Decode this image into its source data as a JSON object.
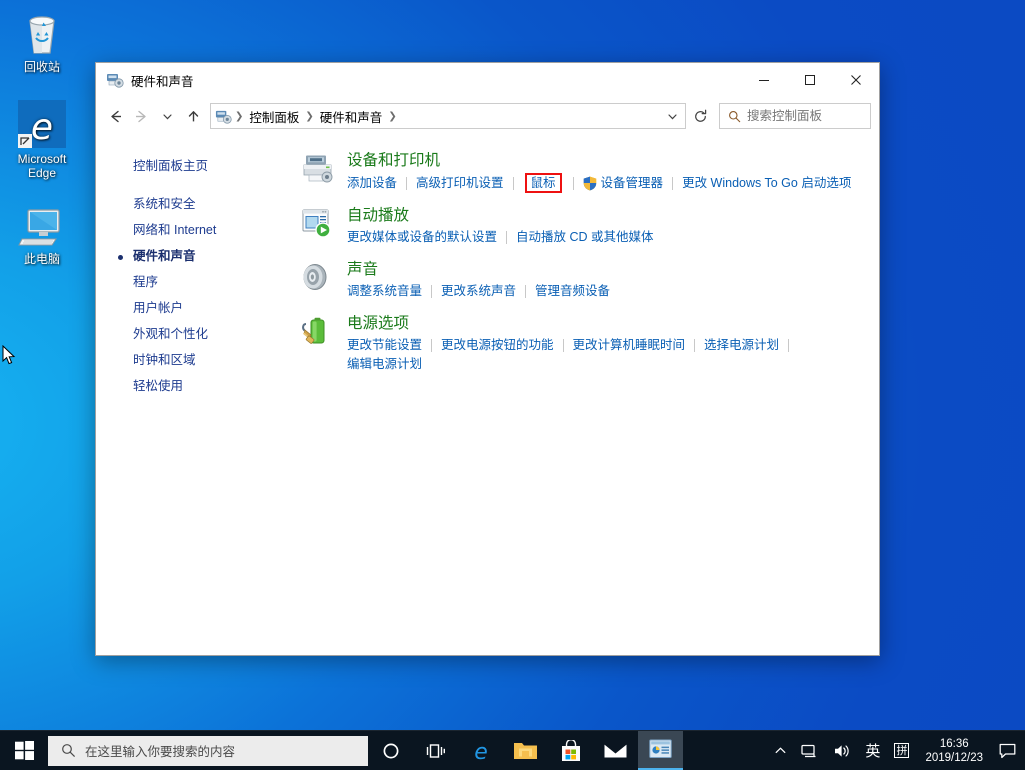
{
  "desktop": {
    "icons": [
      {
        "name": "recycle-bin",
        "label": "回收站"
      },
      {
        "name": "microsoft-edge",
        "label": "Microsoft\nEdge"
      },
      {
        "name": "this-pc",
        "label": "此电脑"
      }
    ],
    "background_start": "#17b4f2",
    "background_end": "#0b49c2"
  },
  "window": {
    "title": "硬件和声音",
    "title_icon": "hardware-sound-icon",
    "controls": {
      "minimize": "—",
      "maximize": "▢",
      "close": "✕"
    },
    "nav": {
      "back": "back-arrow",
      "forward": "forward-arrow",
      "recent": "chevron-down",
      "up": "up-arrow",
      "refresh": "refresh-icon"
    },
    "breadcrumb": [
      "控制面板",
      "硬件和声音"
    ],
    "search": {
      "placeholder": "搜索控制面板",
      "value": ""
    }
  },
  "sidebar": {
    "home": "控制面板主页",
    "items": [
      {
        "label": "系统和安全",
        "active": false
      },
      {
        "label": "网络和 Internet",
        "active": false
      },
      {
        "label": "硬件和声音",
        "active": true
      },
      {
        "label": "程序",
        "active": false
      },
      {
        "label": "用户帐户",
        "active": false
      },
      {
        "label": "外观和个性化",
        "active": false
      },
      {
        "label": "时钟和区域",
        "active": false
      },
      {
        "label": "轻松使用",
        "active": false
      }
    ]
  },
  "categories": [
    {
      "icon": "printer-icon",
      "title": "设备和打印机",
      "links": [
        {
          "text": "添加设备",
          "highlight": false,
          "shield": false
        },
        {
          "text": "高级打印机设置",
          "highlight": false,
          "shield": false
        },
        {
          "text": "鼠标",
          "highlight": true,
          "shield": false
        },
        {
          "text": "设备管理器",
          "highlight": false,
          "shield": true
        },
        {
          "text": "更改 Windows To Go 启动选项",
          "highlight": false,
          "shield": false
        }
      ]
    },
    {
      "icon": "autoplay-icon",
      "title": "自动播放",
      "links": [
        {
          "text": "更改媒体或设备的默认设置",
          "highlight": false,
          "shield": false
        },
        {
          "text": "自动播放 CD 或其他媒体",
          "highlight": false,
          "shield": false
        }
      ]
    },
    {
      "icon": "speaker-icon",
      "title": "声音",
      "links": [
        {
          "text": "调整系统音量",
          "highlight": false,
          "shield": false
        },
        {
          "text": "更改系统声音",
          "highlight": false,
          "shield": false
        },
        {
          "text": "管理音频设备",
          "highlight": false,
          "shield": false
        }
      ]
    },
    {
      "icon": "battery-icon",
      "title": "电源选项",
      "links": [
        {
          "text": "更改节能设置",
          "highlight": false,
          "shield": false
        },
        {
          "text": "更改电源按钮的功能",
          "highlight": false,
          "shield": false
        },
        {
          "text": "更改计算机睡眠时间",
          "highlight": false,
          "shield": false
        },
        {
          "text": "选择电源计划",
          "highlight": false,
          "shield": false
        },
        {
          "text": "编辑电源计划",
          "highlight": false,
          "shield": false
        }
      ]
    }
  ],
  "taskbar": {
    "start": "start-button",
    "search_placeholder": "在这里输入你要搜索的内容",
    "buttons": [
      {
        "name": "cortana-button",
        "icon": "circle-icon"
      },
      {
        "name": "task-view-button",
        "icon": "task-view-icon"
      },
      {
        "name": "edge-button",
        "icon": "edge-icon"
      },
      {
        "name": "file-explorer-button",
        "icon": "folder-icon"
      },
      {
        "name": "microsoft-store-button",
        "icon": "store-icon"
      },
      {
        "name": "mail-button",
        "icon": "mail-icon"
      },
      {
        "name": "control-panel-button",
        "icon": "control-panel-icon",
        "active": true
      }
    ],
    "tray": {
      "show_hidden": "chevron-up-icon",
      "network": "network-icon",
      "volume": "volume-icon",
      "ime_language": "英",
      "ime_mode": "拼",
      "time": "16:36",
      "date": "2019/12/23",
      "action_center": "notification-icon"
    }
  },
  "colors": {
    "heading_green": "#1a7a1a",
    "link_blue": "#0a5fb4",
    "sidebar_blue": "#1d3b8f",
    "highlight_red": "#ee1111",
    "taskbar": "#0a1520"
  }
}
